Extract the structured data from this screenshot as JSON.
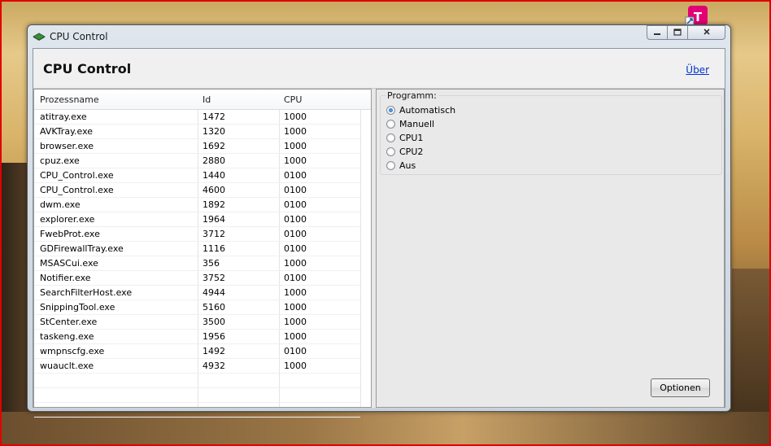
{
  "window": {
    "title": "CPU Control"
  },
  "header": {
    "title": "CPU Control",
    "about_link": "Über"
  },
  "process_list": {
    "columns": [
      "Prozessname",
      "Id",
      "CPU"
    ],
    "rows": [
      [
        "atitray.exe",
        "1472",
        "1000"
      ],
      [
        "AVKTray.exe",
        "1320",
        "1000"
      ],
      [
        "browser.exe",
        "1692",
        "1000"
      ],
      [
        "cpuz.exe",
        "2880",
        "1000"
      ],
      [
        "CPU_Control.exe",
        "1440",
        "0100"
      ],
      [
        "CPU_Control.exe",
        "4600",
        "0100"
      ],
      [
        "dwm.exe",
        "1892",
        "0100"
      ],
      [
        "explorer.exe",
        "1964",
        "0100"
      ],
      [
        "FwebProt.exe",
        "3712",
        "0100"
      ],
      [
        "GDFirewallTray.exe",
        "1116",
        "0100"
      ],
      [
        "MSASCui.exe",
        "356",
        "1000"
      ],
      [
        "Notifier.exe",
        "3752",
        "0100"
      ],
      [
        "SearchFilterHost.exe",
        "4944",
        "1000"
      ],
      [
        "SnippingTool.exe",
        "5160",
        "1000"
      ],
      [
        "StCenter.exe",
        "3500",
        "1000"
      ],
      [
        "taskeng.exe",
        "1956",
        "1000"
      ],
      [
        "wmpnscfg.exe",
        "1492",
        "0100"
      ],
      [
        "wuauclt.exe",
        "4932",
        "1000"
      ]
    ]
  },
  "program_group": {
    "legend": "Programm:",
    "options": [
      "Automatisch",
      "Manuell",
      "CPU1",
      "CPU2",
      "Aus"
    ],
    "selected": "Automatisch"
  },
  "buttons": {
    "options_label": "Optionen"
  },
  "icons": {
    "app_icon": "cpu-chip-icon",
    "desktop_icon": "telekom-shortcut-icon",
    "minimize": "minimize-icon",
    "maximize": "maximize-icon",
    "close": "close-icon"
  },
  "colors": {
    "accent_radio": "#1a5fc4",
    "link": "#0033cc",
    "frame": "#e00000"
  }
}
